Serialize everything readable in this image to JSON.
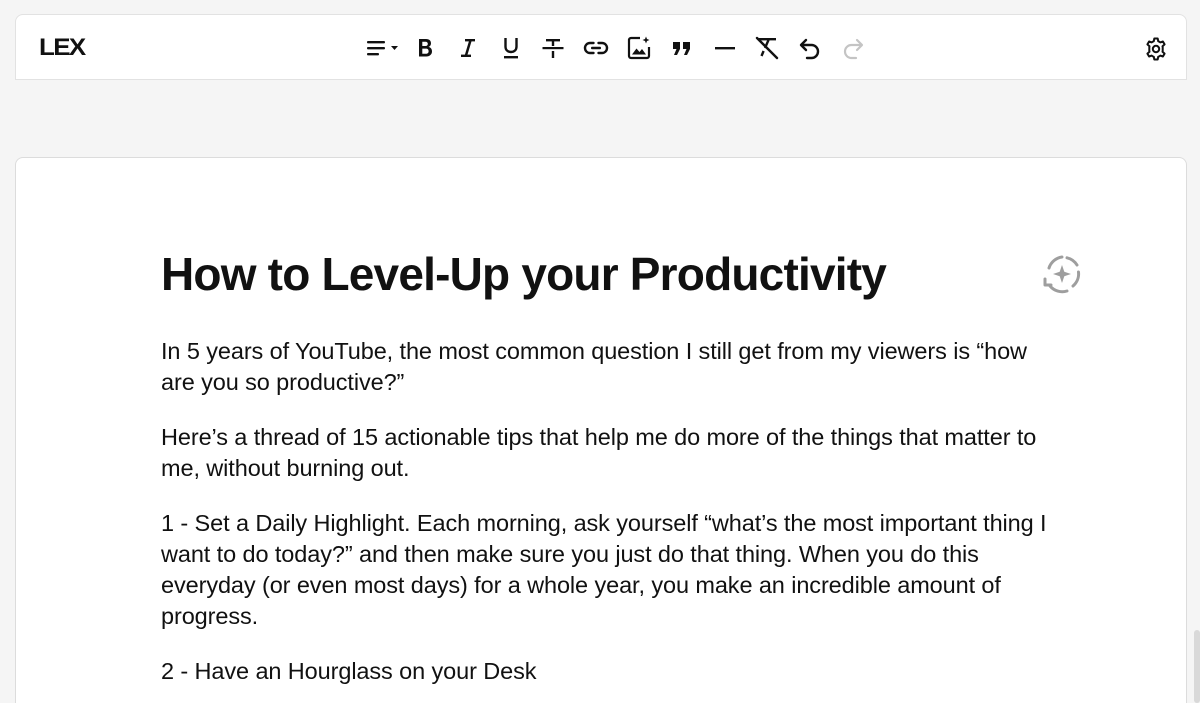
{
  "app": {
    "logo": "LEX"
  },
  "toolbar": {
    "tools": [
      {
        "name": "align",
        "icon": "align-left-icon"
      },
      {
        "name": "bold",
        "icon": "bold-icon"
      },
      {
        "name": "italic",
        "icon": "italic-icon"
      },
      {
        "name": "underline",
        "icon": "underline-icon"
      },
      {
        "name": "strikethrough",
        "icon": "strikethrough-icon"
      },
      {
        "name": "link",
        "icon": "link-icon"
      },
      {
        "name": "image",
        "icon": "image-add-icon"
      },
      {
        "name": "quote",
        "icon": "quote-icon"
      },
      {
        "name": "divider",
        "icon": "horizontal-rule-icon"
      },
      {
        "name": "clear-format",
        "icon": "clear-format-icon"
      },
      {
        "name": "undo",
        "icon": "undo-icon"
      },
      {
        "name": "redo",
        "icon": "redo-icon",
        "disabled": true
      }
    ],
    "settings_icon": "gear-icon"
  },
  "document": {
    "title": "How to Level-Up your Productivity",
    "paragraphs": [
      "In 5 years of YouTube, the most common question I still get from my viewers is “how are you so productive?”",
      "Here’s a thread of 15 actionable tips that help me do more of the things that matter to me, without burning out.",
      "1 - Set a Daily Highlight. Each morning, ask yourself “what’s the most important thing I want to do today?” and then make sure you just do that thing. When you do this everyday (or even most days) for a whole year, you make an incredible amount of progress.",
      "2 - Have an Hourglass on your Desk"
    ]
  },
  "colors": {
    "background": "#f5f5f5",
    "surface": "#ffffff",
    "text": "#111111",
    "muted_icon": "#9e9e9e",
    "disabled_icon": "#c4c4c4"
  }
}
